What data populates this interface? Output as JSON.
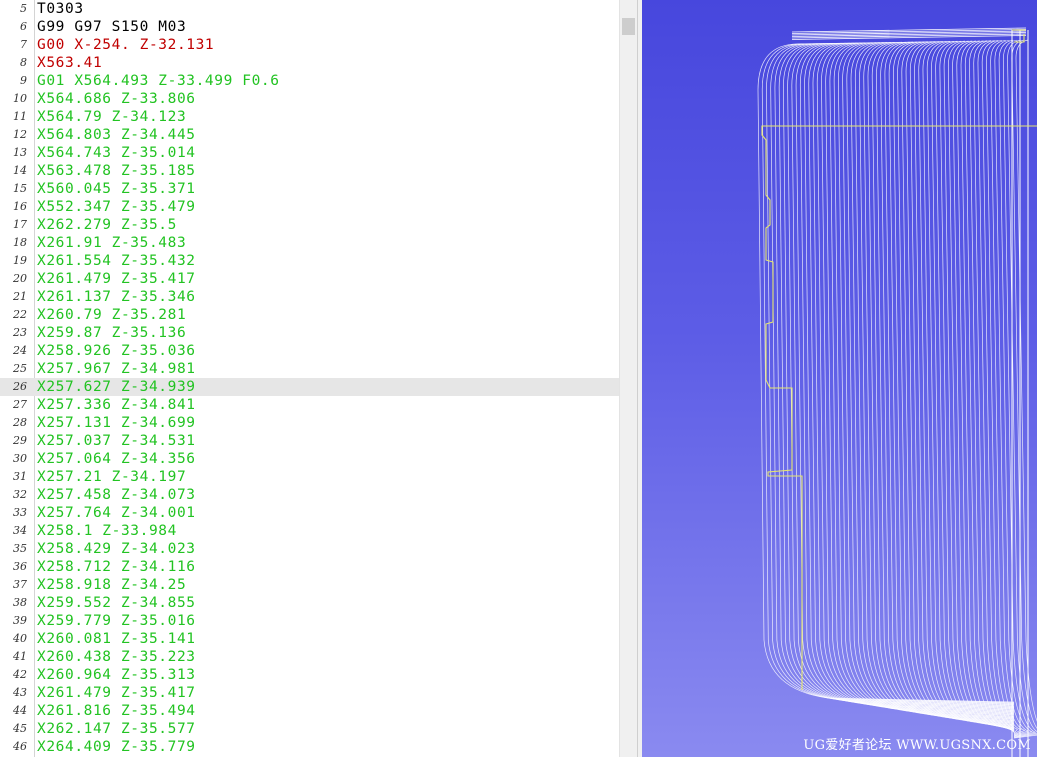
{
  "editor": {
    "current_line_number": "26",
    "lines": [
      {
        "num": "5",
        "tokens": [
          {
            "t": "T0303",
            "c": "#000000"
          }
        ]
      },
      {
        "num": "6",
        "tokens": [
          {
            "t": "G99 G97 S150 M03",
            "c": "#000000"
          }
        ]
      },
      {
        "num": "7",
        "tokens": [
          {
            "t": "G00 X-254. Z-32.131",
            "c": "#c00000"
          }
        ]
      },
      {
        "num": "8",
        "tokens": [
          {
            "t": "X563.41",
            "c": "#c00000"
          }
        ]
      },
      {
        "num": "9",
        "tokens": [
          {
            "t": "G01 X564.493 Z-33.499 F0.6",
            "c": "#22c322"
          }
        ]
      },
      {
        "num": "10",
        "tokens": [
          {
            "t": "X564.686 Z-33.806",
            "c": "#22c322"
          }
        ]
      },
      {
        "num": "11",
        "tokens": [
          {
            "t": "X564.79 Z-34.123",
            "c": "#22c322"
          }
        ]
      },
      {
        "num": "12",
        "tokens": [
          {
            "t": "X564.803 Z-34.445",
            "c": "#22c322"
          }
        ]
      },
      {
        "num": "13",
        "tokens": [
          {
            "t": "X564.743 Z-35.014",
            "c": "#22c322"
          }
        ]
      },
      {
        "num": "14",
        "tokens": [
          {
            "t": "X563.478 Z-35.185",
            "c": "#22c322"
          }
        ]
      },
      {
        "num": "15",
        "tokens": [
          {
            "t": "X560.045 Z-35.371",
            "c": "#22c322"
          }
        ]
      },
      {
        "num": "16",
        "tokens": [
          {
            "t": "X552.347 Z-35.479",
            "c": "#22c322"
          }
        ]
      },
      {
        "num": "17",
        "tokens": [
          {
            "t": "X262.279 Z-35.5",
            "c": "#22c322"
          }
        ]
      },
      {
        "num": "18",
        "tokens": [
          {
            "t": "X261.91 Z-35.483",
            "c": "#22c322"
          }
        ]
      },
      {
        "num": "19",
        "tokens": [
          {
            "t": "X261.554 Z-35.432",
            "c": "#22c322"
          }
        ]
      },
      {
        "num": "20",
        "tokens": [
          {
            "t": "X261.479 Z-35.417",
            "c": "#22c322"
          }
        ]
      },
      {
        "num": "21",
        "tokens": [
          {
            "t": "X261.137 Z-35.346",
            "c": "#22c322"
          }
        ]
      },
      {
        "num": "22",
        "tokens": [
          {
            "t": "X260.79 Z-35.281",
            "c": "#22c322"
          }
        ]
      },
      {
        "num": "23",
        "tokens": [
          {
            "t": "X259.87 Z-35.136",
            "c": "#22c322"
          }
        ]
      },
      {
        "num": "24",
        "tokens": [
          {
            "t": "X258.926 Z-35.036",
            "c": "#22c322"
          }
        ]
      },
      {
        "num": "25",
        "tokens": [
          {
            "t": "X257.967 Z-34.981",
            "c": "#22c322"
          }
        ]
      },
      {
        "num": "26",
        "tokens": [
          {
            "t": "X257.627 Z-34.939",
            "c": "#22c322"
          }
        ]
      },
      {
        "num": "27",
        "tokens": [
          {
            "t": "X257.336 Z-34.841",
            "c": "#22c322"
          }
        ]
      },
      {
        "num": "28",
        "tokens": [
          {
            "t": "X257.131 Z-34.699",
            "c": "#22c322"
          }
        ]
      },
      {
        "num": "29",
        "tokens": [
          {
            "t": "X257.037 Z-34.531",
            "c": "#22c322"
          }
        ]
      },
      {
        "num": "30",
        "tokens": [
          {
            "t": "X257.064 Z-34.356",
            "c": "#22c322"
          }
        ]
      },
      {
        "num": "31",
        "tokens": [
          {
            "t": "X257.21 Z-34.197",
            "c": "#22c322"
          }
        ]
      },
      {
        "num": "32",
        "tokens": [
          {
            "t": "X257.458 Z-34.073",
            "c": "#22c322"
          }
        ]
      },
      {
        "num": "33",
        "tokens": [
          {
            "t": "X257.764 Z-34.001",
            "c": "#22c322"
          }
        ]
      },
      {
        "num": "34",
        "tokens": [
          {
            "t": "X258.1 Z-33.984",
            "c": "#22c322"
          }
        ]
      },
      {
        "num": "35",
        "tokens": [
          {
            "t": "X258.429 Z-34.023",
            "c": "#22c322"
          }
        ]
      },
      {
        "num": "36",
        "tokens": [
          {
            "t": "X258.712 Z-34.116",
            "c": "#22c322"
          }
        ]
      },
      {
        "num": "37",
        "tokens": [
          {
            "t": "X258.918 Z-34.25",
            "c": "#22c322"
          }
        ]
      },
      {
        "num": "38",
        "tokens": [
          {
            "t": "X259.552 Z-34.855",
            "c": "#22c322"
          }
        ]
      },
      {
        "num": "39",
        "tokens": [
          {
            "t": "X259.779 Z-35.016",
            "c": "#22c322"
          }
        ]
      },
      {
        "num": "40",
        "tokens": [
          {
            "t": "X260.081 Z-35.141",
            "c": "#22c322"
          }
        ]
      },
      {
        "num": "41",
        "tokens": [
          {
            "t": "X260.438 Z-35.223",
            "c": "#22c322"
          }
        ]
      },
      {
        "num": "42",
        "tokens": [
          {
            "t": "X260.964 Z-35.313",
            "c": "#22c322"
          }
        ]
      },
      {
        "num": "43",
        "tokens": [
          {
            "t": "X261.479 Z-35.417",
            "c": "#22c322"
          }
        ]
      },
      {
        "num": "44",
        "tokens": [
          {
            "t": "X261.816 Z-35.494",
            "c": "#22c322"
          }
        ]
      },
      {
        "num": "45",
        "tokens": [
          {
            "t": "X262.147 Z-35.577",
            "c": "#22c322"
          }
        ]
      },
      {
        "num": "46",
        "tokens": [
          {
            "t": "X264.409 Z-35.779",
            "c": "#22c322"
          }
        ]
      }
    ]
  },
  "viewer": {
    "watermark": "UG爱好者论坛 WWW.UGSNX.COM",
    "colors": {
      "toolpath": "#ffffff",
      "stock_outline": "#e6e66e",
      "background_top": "#4747dd",
      "background_bottom": "#8a8af0"
    }
  }
}
